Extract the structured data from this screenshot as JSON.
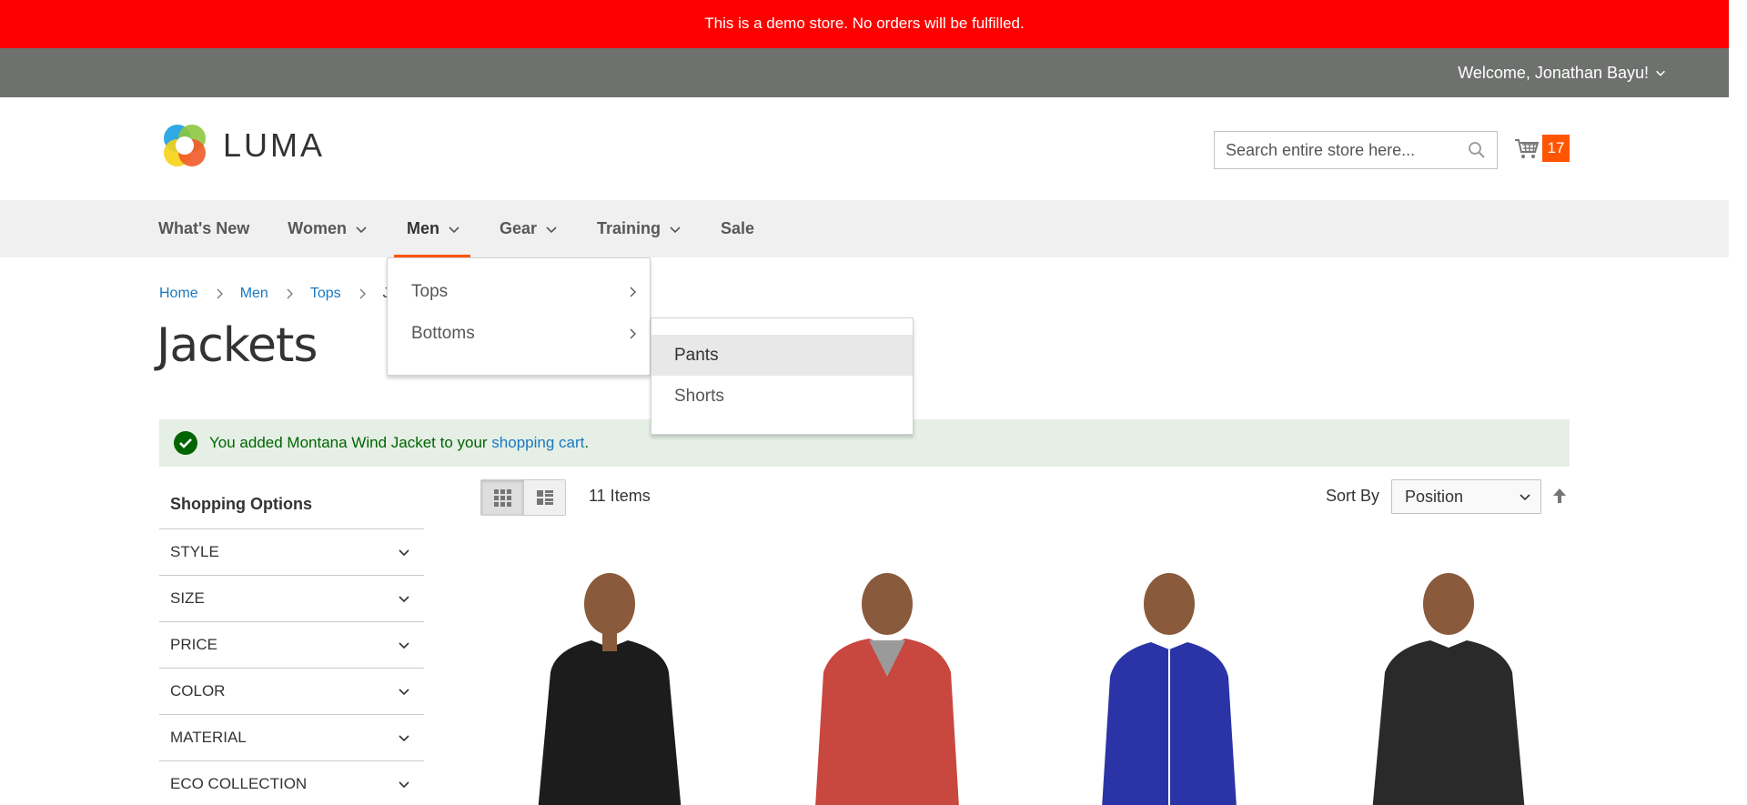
{
  "banner": {
    "text": "This is a demo store. No orders will be fulfilled."
  },
  "header": {
    "welcome": "Welcome, Jonathan Bayu!"
  },
  "logo": {
    "text": "LUMA"
  },
  "search": {
    "placeholder": "Search entire store here..."
  },
  "cart": {
    "count": "17"
  },
  "nav": {
    "items": [
      {
        "label": "What's New"
      },
      {
        "label": "Women"
      },
      {
        "label": "Men"
      },
      {
        "label": "Gear"
      },
      {
        "label": "Training"
      },
      {
        "label": "Sale"
      }
    ]
  },
  "dropdown": {
    "items": [
      {
        "label": "Tops"
      },
      {
        "label": "Bottoms"
      }
    ],
    "submenu": [
      {
        "label": "Pants"
      },
      {
        "label": "Shorts"
      }
    ]
  },
  "breadcrumbs": [
    {
      "label": "Home"
    },
    {
      "label": "Men"
    },
    {
      "label": "Tops"
    },
    {
      "label": "Ja"
    }
  ],
  "page": {
    "title": "Jackets"
  },
  "message": {
    "prefix": "You added Montana Wind Jacket to your ",
    "link": "shopping cart",
    "suffix": "."
  },
  "sidebar": {
    "title": "Shopping Options",
    "filters": [
      {
        "label": "STYLE"
      },
      {
        "label": "SIZE"
      },
      {
        "label": "PRICE"
      },
      {
        "label": "COLOR"
      },
      {
        "label": "MATERIAL"
      },
      {
        "label": "ECO COLLECTION"
      }
    ]
  },
  "toolbar": {
    "count": "11 Items",
    "sort_label": "Sort By",
    "sort_value": "Position"
  },
  "colors": {
    "banner": "#ff0000",
    "header": "#6e716e",
    "accent": "#ff5501",
    "link": "#1979c3",
    "success_bg": "#e5efe5",
    "success_text": "#006400"
  },
  "products": [
    {
      "jacket_color": "#1c1c1c"
    },
    {
      "jacket_color": "#c8473f"
    },
    {
      "jacket_color": "#2b34a6"
    },
    {
      "jacket_color": "#2a2a2a"
    }
  ]
}
